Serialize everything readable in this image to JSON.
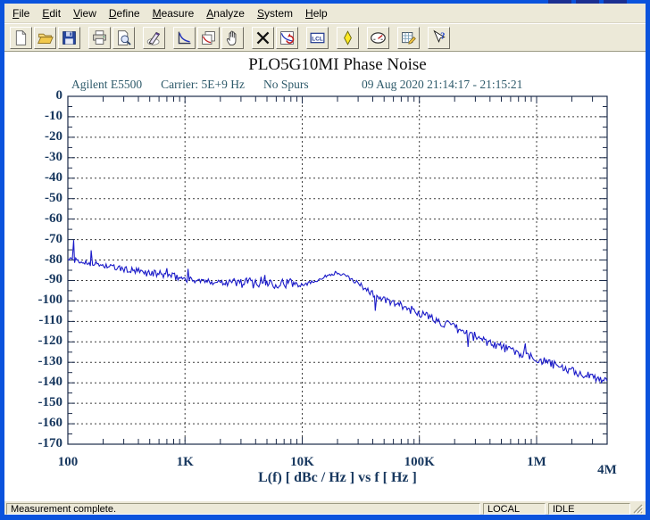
{
  "theme": {
    "window_border": "#0a53dd",
    "titlebar_remnant": "#1b2f91",
    "chrome_bg": "#ece9d8",
    "client_bg": "#ffffff"
  },
  "menu": {
    "items": [
      "File",
      "Edit",
      "View",
      "Define",
      "Measure",
      "Analyze",
      "System",
      "Help"
    ]
  },
  "toolbar": {
    "groups": [
      [
        "new-document",
        "open-file",
        "save-file"
      ],
      [
        "print",
        "print-preview"
      ],
      [
        "define-measurement-pen"
      ],
      [
        "graph-measurement",
        "copy-graph",
        "pan-hand"
      ],
      [
        "abort-measurement",
        "repeat-measurement"
      ],
      [
        "local-lcl"
      ],
      [
        "marker-diamond"
      ],
      [
        "meter-gauge"
      ],
      [
        "spreadsheet-edit"
      ],
      [
        "context-help"
      ]
    ]
  },
  "chart_data": {
    "type": "line",
    "title": "PLO5G10MI Phase Noise",
    "annotations_left": [
      "Agilent E5500",
      "Carrier: 5E+9 Hz",
      "No Spurs"
    ],
    "annotation_right": "09 Aug 2020  21:14:17 - 21:15:21",
    "xlabel": "L(f)  [ dBc / Hz ]  vs  f  [ Hz ]",
    "x_scale": "log",
    "xlim": [
      100,
      4000000
    ],
    "ylim": [
      -170,
      0
    ],
    "y_major_step": 10,
    "y_minor_step": 5,
    "grid": "dashed",
    "x_ticks": [
      {
        "label": "100",
        "f": 100,
        "dy": 0
      },
      {
        "label": "1K",
        "f": 1000,
        "dy": 0
      },
      {
        "label": "10K",
        "f": 10000,
        "dy": 0
      },
      {
        "label": "100K",
        "f": 100000,
        "dy": 0
      },
      {
        "label": "1M",
        "f": 1000000,
        "dy": 0
      },
      {
        "label": "4M",
        "f": 4000000,
        "dy": 9
      }
    ],
    "trace_color": "#1a1ac8",
    "axis_color": "#1c2b4a",
    "grid_color": "#3c3c3c",
    "tick_label_color": "#17375e",
    "annotation_color": "#2e5a6a",
    "title_color": "#111111",
    "series": [
      {
        "name": "L(f) phase noise of PLO5G10MI at 5 GHz carrier (dBc/Hz vs offset Hz)",
        "anchors": [
          [
            100,
            -79.5,
            1.4
          ],
          [
            130,
            -81.0,
            1.4
          ],
          [
            170,
            -81.8,
            1.4
          ],
          [
            230,
            -83.3,
            1.5
          ],
          [
            320,
            -84.8,
            1.6
          ],
          [
            430,
            -86.0,
            1.8
          ],
          [
            560,
            -86.6,
            1.8
          ],
          [
            700,
            -87.5,
            1.8
          ],
          [
            900,
            -88.6,
            1.8
          ],
          [
            1100,
            -89.6,
            1.5
          ],
          [
            1600,
            -90.6,
            1.3
          ],
          [
            2200,
            -90.6,
            2.0
          ],
          [
            3000,
            -91.0,
            2.7
          ],
          [
            4500,
            -91.0,
            2.9
          ],
          [
            6500,
            -91.0,
            2.9
          ],
          [
            8500,
            -91.5,
            2.3
          ],
          [
            10500,
            -91.6,
            1.2
          ],
          [
            12500,
            -90.6,
            0.7
          ],
          [
            15000,
            -88.6,
            0.7
          ],
          [
            17500,
            -86.9,
            0.8
          ],
          [
            19500,
            -86.3,
            0.9
          ],
          [
            22000,
            -87.2,
            0.9
          ],
          [
            25000,
            -88.6,
            0.9
          ],
          [
            28000,
            -90.3,
            1.1
          ],
          [
            32000,
            -92.5,
            1.3
          ],
          [
            40000,
            -96.5,
            1.7
          ],
          [
            50000,
            -99.5,
            1.9
          ],
          [
            65000,
            -102.0,
            2.2
          ],
          [
            80000,
            -103.8,
            2.1
          ],
          [
            100000,
            -105.8,
            2.1
          ],
          [
            140000,
            -109.5,
            2.3
          ],
          [
            200000,
            -113.3,
            2.4
          ],
          [
            300000,
            -117.5,
            2.4
          ],
          [
            450000,
            -121.3,
            2.2
          ],
          [
            650000,
            -124.8,
            2.1
          ],
          [
            900000,
            -127.6,
            2.0
          ],
          [
            1200000,
            -129.8,
            2.0
          ],
          [
            1700000,
            -133.0,
            2.0
          ],
          [
            2400000,
            -135.8,
            2.0
          ],
          [
            3200000,
            -137.6,
            2.1
          ],
          [
            4000000,
            -138.3,
            2.1
          ]
        ],
        "spikes": [
          [
            112,
            -70.3
          ],
          [
            158,
            -75.3
          ],
          [
            700,
            -84.0
          ],
          [
            1060,
            -84.3
          ],
          [
            4800,
            -87.3
          ],
          [
            42000,
            -104.8
          ],
          [
            260000,
            -122.5
          ],
          [
            800000,
            -120.8
          ]
        ]
      }
    ]
  },
  "status_bar": {
    "message": "Measurement complete.",
    "panels": [
      "LOCAL",
      "IDLE"
    ]
  }
}
